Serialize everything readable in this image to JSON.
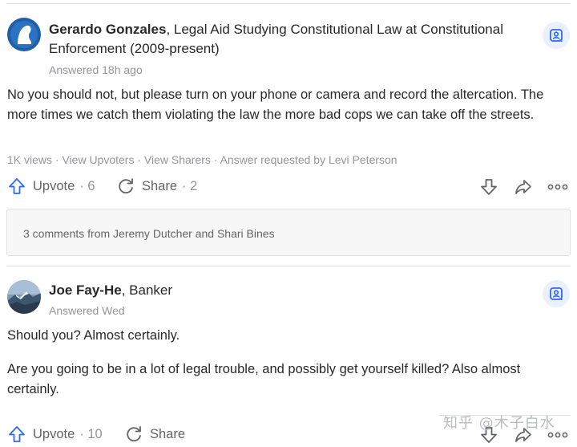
{
  "answer1": {
    "author_name": "Gerardo Gonzales",
    "author_credential_line1": ", Legal Aid Studying Constitutional Law at Constitutional",
    "author_credential_line2": "Enforcement (2009-present)",
    "answered": "Answered 18h ago",
    "body": "No you should not, but please turn on your phone or camera and record the altercation. The more times we catch them violating the law the more bad cops we can take off the streets.",
    "stats": "1K views · View Upvoters · View Sharers · Answer requested by Levi Peterson",
    "upvote_label": "Upvote",
    "upvote_count": "· 6",
    "share_label": "Share",
    "share_count": "· 2",
    "comments": "3 comments from Jeremy Dutcher and Shari Bines"
  },
  "answer2": {
    "author_name": "Joe Fay-He",
    "author_credential": ", Banker",
    "answered": "Answered Wed",
    "body_p1": "Should you? Almost certainly.",
    "body_p2": "Are you going to be in a lot of legal trouble, and possibly get yourself killed? Also almost certainly.",
    "upvote_label": "Upvote",
    "upvote_count": "· 10",
    "share_label": "Share"
  },
  "watermark": "知乎 @木子白水",
  "colors": {
    "accent": "#2e69ff",
    "text": "#282829",
    "muted": "#939598",
    "action": "#636466"
  },
  "icons": [
    "upvote-icon",
    "share-icon",
    "downvote-icon",
    "forward-icon",
    "more-icon",
    "request-answer-icon"
  ]
}
